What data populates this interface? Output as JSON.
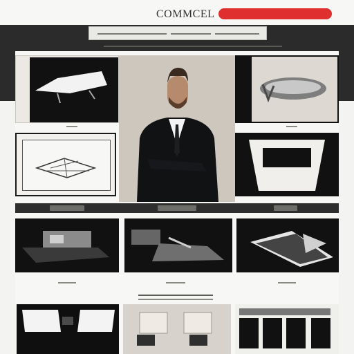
{
  "header": {
    "logo_text": "COMMCEL"
  },
  "colors": {
    "accent": "#e02f2f",
    "dark_band": "#2b2b2b",
    "panel": "#f7f7f5",
    "card_dark": "#111111",
    "portrait_bg": "#cdc7bd"
  },
  "icons": {
    "hero_left_top": "abstract-wing-sculpture",
    "hero_right_top": "metal-ring-sculpture",
    "hero_left_bottom": "architectural-sketch",
    "hero_right_bottom": "black-frame-shape",
    "gallery_1": "machinery-model",
    "gallery_2": "industrial-installation",
    "gallery_3": "angled-plates-sculpture",
    "bottom_1": "stage-interior",
    "bottom_2": "lounge-interior",
    "bottom_3": "storefront"
  }
}
